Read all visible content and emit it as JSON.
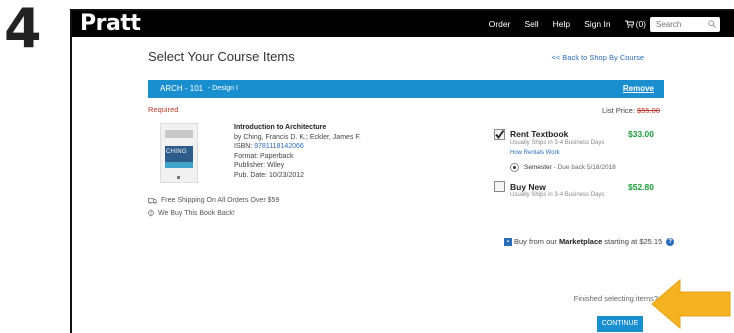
{
  "step_number": "4",
  "header": {
    "logo": "Pratt",
    "nav": [
      "Order",
      "Sell",
      "Help",
      "Sign In"
    ],
    "cart_label": "(0)",
    "search_placeholder": "Search"
  },
  "page": {
    "title": "Select Your Course Items",
    "back_link": "<< Back to Shop By Course"
  },
  "course": {
    "code": "ARCH - 101",
    "name": "- Design I",
    "remove": "Remove"
  },
  "required_label": "Required",
  "list_price": {
    "label": "List Price:",
    "value": "$55.00"
  },
  "cover": {
    "text": "CHING"
  },
  "book": {
    "title": "Introduction to Architecture",
    "author": "by Ching, Francis D. K.; Eckler, James F.",
    "isbn_label": "ISBN:",
    "isbn": "9781118142066",
    "format": "Format: Paperback",
    "publisher": "Publisher: Wiley",
    "pub_date": "Pub. Date: 10/23/2012"
  },
  "perks": {
    "shipping": "Free Shipping On All Orders Over $59",
    "buyback": "We Buy This Book Back!"
  },
  "rent": {
    "label": "Rent Textbook",
    "sub": "Usually Ships in 3-4 Business Days",
    "price": "$33.00",
    "how_link": "How Rentals Work",
    "semester_label": "Semester",
    "semester_due": "- Due back 5/18/2018",
    "checked": true
  },
  "buy": {
    "label": "Buy New",
    "sub": "Usually Ships in 3-4 Business Days",
    "price": "$52.80",
    "checked": false
  },
  "marketplace": {
    "prefix": "Buy from our",
    "name": "Marketplace",
    "suffix": "starting at $25.15"
  },
  "footer": {
    "finished": "Finished selecting items?",
    "continue": "CONTINUE"
  },
  "colors": {
    "accent_blue": "#1a8fcf",
    "price_green": "#1f9d3a",
    "required_red": "#c0392b",
    "arrow_orange": "#f5b324"
  }
}
